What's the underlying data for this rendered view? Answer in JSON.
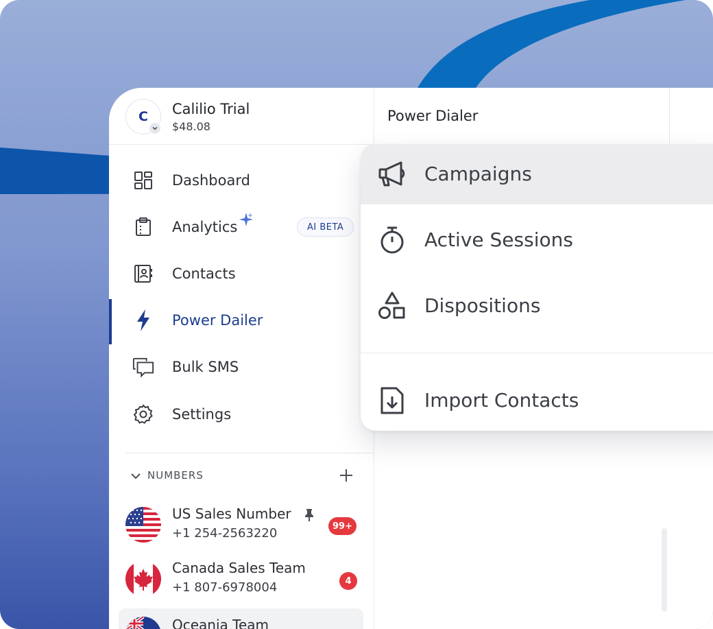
{
  "account": {
    "avatar_letter": "C",
    "name": "Calilio Trial",
    "balance": "$48.08"
  },
  "nav": {
    "items": [
      {
        "label": "Dashboard",
        "icon": "dashboard-icon"
      },
      {
        "label": "Analytics",
        "icon": "clipboard-icon",
        "badge": "AI BETA"
      },
      {
        "label": "Contacts",
        "icon": "contacts-book-icon"
      },
      {
        "label": "Power Dailer",
        "icon": "lightning-icon",
        "active": true
      },
      {
        "label": "Bulk SMS",
        "icon": "chat-bubbles-icon"
      },
      {
        "label": "Settings",
        "icon": "gear-icon"
      }
    ]
  },
  "numbers": {
    "title": "NUMBERS",
    "items": [
      {
        "name": "US Sales Number",
        "phone": "+1 254-2563220",
        "badge": "99+",
        "pinned": true,
        "flag": "us-flag"
      },
      {
        "name": "Canada Sales Team",
        "phone": "+1 807-6978004",
        "badge": "4",
        "flag": "canada-flag"
      },
      {
        "name": "Oceania Team",
        "phone": "",
        "flag": "australia-flag"
      }
    ]
  },
  "header": {
    "title": "Power Dialer"
  },
  "dropdown": {
    "items": [
      {
        "label": "Campaigns",
        "icon": "megaphone-icon"
      },
      {
        "label": "Active Sessions",
        "icon": "stopwatch-icon"
      },
      {
        "label": "Dispositions",
        "icon": "shapes-icon"
      },
      {
        "label": "Import Contacts",
        "icon": "import-file-icon"
      }
    ]
  },
  "colors": {
    "accent": "#1d3c8f",
    "badge_red": "#e5393f",
    "background_blue": "#8097cf"
  }
}
